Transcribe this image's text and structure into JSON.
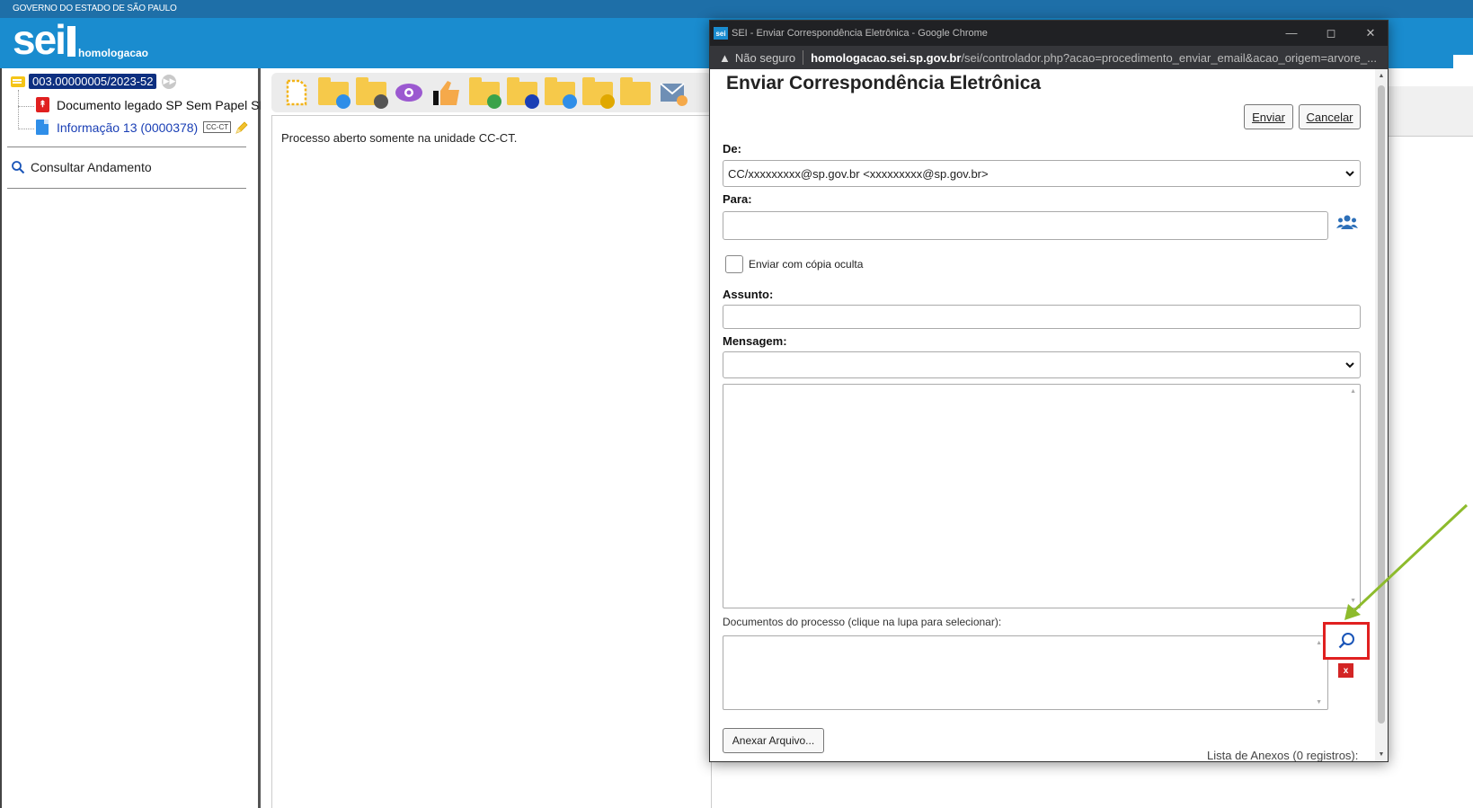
{
  "header": {
    "government_label": "GOVERNO DO ESTADO DE SÃO PAULO",
    "logo_text": "sei",
    "environment_label": "homologacao"
  },
  "tree": {
    "process_number": "003.00000005/2023-52",
    "documents": [
      {
        "label": "Documento legado SP Sem Papel SN",
        "icon": "pdf-icon"
      },
      {
        "label": "Informação 13 (0000378)",
        "badge": "CC-CT",
        "icon": "document-icon"
      }
    ],
    "consult_link": "Consultar Andamento"
  },
  "main": {
    "process_note": "Processo aberto somente na unidade CC-CT.",
    "toolbar_icons": [
      "new-document-icon",
      "folder-sync-icon",
      "folder-settings-icon",
      "eye-icon",
      "thumbs-up-icon",
      "folder-send-icon",
      "folder-info-icon",
      "folder-user-icon",
      "folder-star-icon",
      "folder-icon",
      "email-icon"
    ]
  },
  "chrome": {
    "window_title": "SEI - Enviar Correspondência Eletrônica - Google Chrome",
    "insecure_label": "Não seguro",
    "url_host": "homologacao.sei.sp.gov.br",
    "url_path": "/sei/controlador.php?acao=procedimento_enviar_email&acao_origem=arvore_..."
  },
  "form": {
    "title": "Enviar Correspondência Eletrônica",
    "send_button": "Enviar",
    "cancel_button": "Cancelar",
    "from_label": "De:",
    "from_value": "CC/xxxxxxxxx@sp.gov.br <xxxxxxxxx@sp.gov.br>",
    "to_label": "Para:",
    "to_value": "",
    "bcc_label": "Enviar com cópia oculta",
    "bcc_checked": false,
    "subject_label": "Assunto:",
    "subject_value": "",
    "message_label": "Mensagem:",
    "message_template": "",
    "message_body": "",
    "documents_label": "Documentos do processo (clique na lupa para selecionar):",
    "remove_glyph": "x",
    "attach_button": "Anexar Arquivo...",
    "attachments_count_label": "Lista de Anexos (0 registros):"
  },
  "colors": {
    "header_blue": "#1a8ccf",
    "process_highlight": "#0d2f80",
    "highlight_red": "#e02020",
    "arrow_green": "#8dbb2c"
  }
}
